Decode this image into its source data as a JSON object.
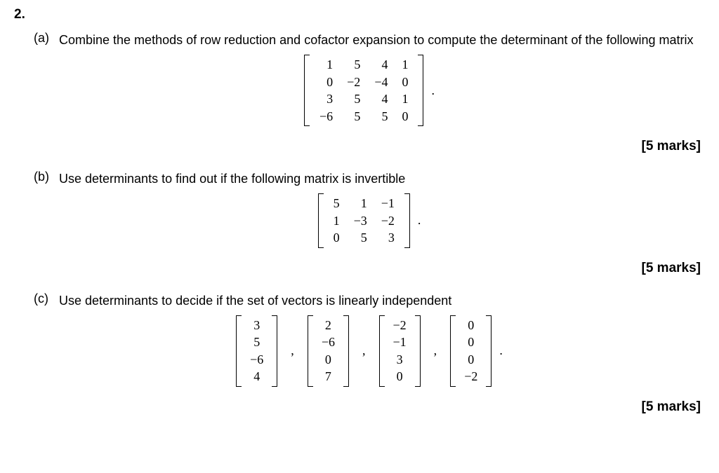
{
  "question_number": "2.",
  "parts": {
    "a": {
      "label": "(a)",
      "text": "Combine the methods of row reduction and cofactor expansion to compute the determinant of the following matrix",
      "matrix": [
        [
          "1",
          "5",
          "4",
          "1"
        ],
        [
          "0",
          "−2",
          "−4",
          "0"
        ],
        [
          "3",
          "5",
          "4",
          "1"
        ],
        [
          "−6",
          "5",
          "5",
          "0"
        ]
      ],
      "trail": ".",
      "marks": "[5 marks]"
    },
    "b": {
      "label": "(b)",
      "text": "Use determinants to find out if the following matrix is invertible",
      "matrix": [
        [
          "5",
          "1",
          "−1"
        ],
        [
          "1",
          "−3",
          "−2"
        ],
        [
          "0",
          "5",
          "3"
        ]
      ],
      "trail": ".",
      "marks": "[5 marks]"
    },
    "c": {
      "label": "(c)",
      "text": "Use determinants to decide if the set of vectors is linearly independent",
      "vectors": [
        [
          "3",
          "5",
          "−6",
          "4"
        ],
        [
          "2",
          "−6",
          "0",
          "7"
        ],
        [
          "−2",
          "−1",
          "3",
          "0"
        ],
        [
          "0",
          "0",
          "0",
          "−2"
        ]
      ],
      "sep": ",",
      "trail": ".",
      "marks": "[5 marks]"
    }
  }
}
